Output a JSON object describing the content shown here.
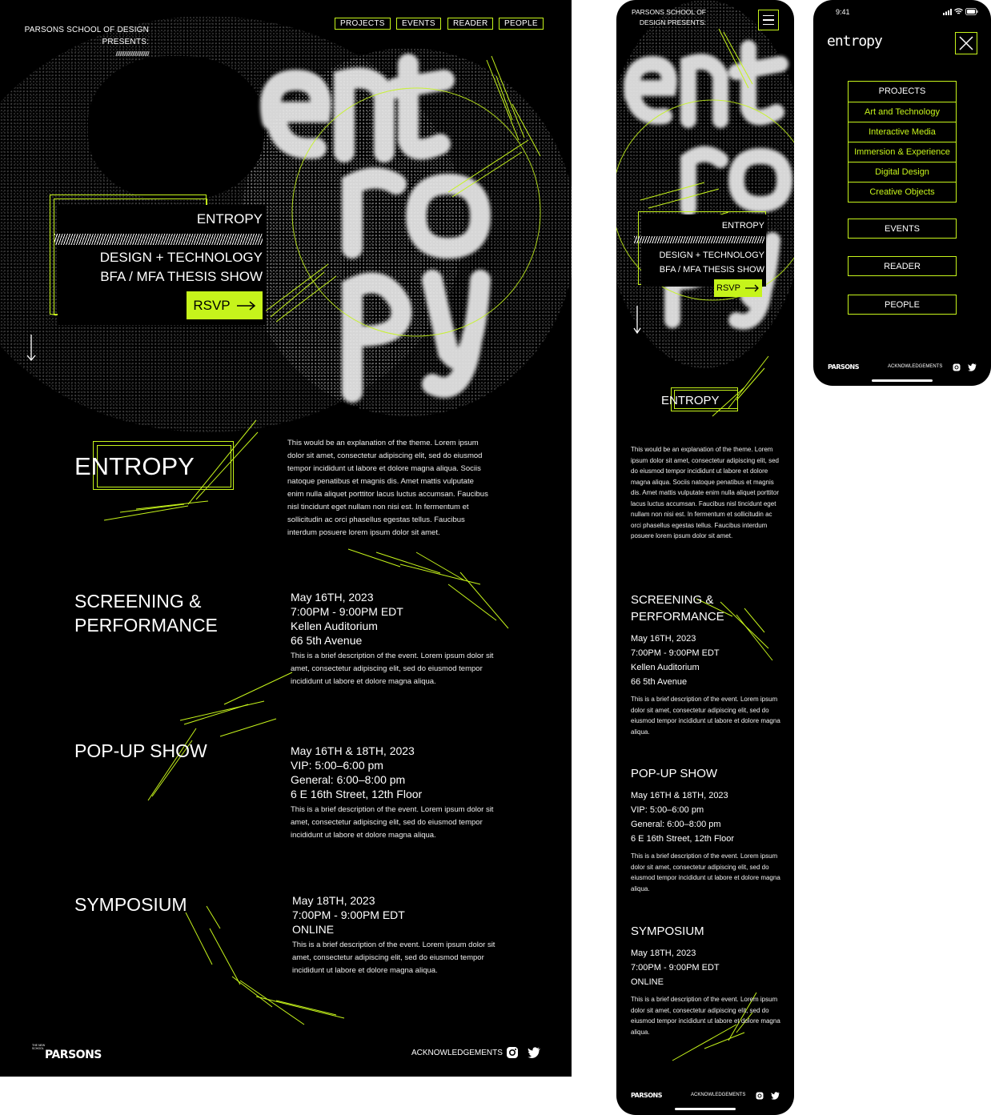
{
  "desktop": {
    "presenter_line1": "PARSONS SCHOOL OF DESIGN",
    "presenter_line2": "PRESENTS:",
    "presenter_slashes": "////////////////////////",
    "nav": [
      "PROJECTS",
      "EVENTS",
      "READER",
      "PEOPLE"
    ],
    "hero": {
      "title": "ENTROPY",
      "subtitle1": "DESIGN + TECHNOLOGY",
      "subtitle2": "BFA / MFA THESIS SHOW",
      "rsvp_label": "RSVP"
    },
    "about": {
      "heading": "ENTROPY",
      "body": "This would be an explanation of the theme. Lorem ipsum dolor sit amet, consectetur adipiscing elit, sed do eiusmod tempor incididunt ut labore et dolore magna aliqua. Sociis natoque penatibus et magnis dis. Amet mattis vulputate enim nulla aliquet porttitor lacus luctus accumsan. Faucibus nisl tincidunt eget nullam non nisi est. In fermentum et sollicitudin ac orci phasellus egestas tellus. Faucibus interdum posuere lorem ipsum dolor sit amet."
    },
    "events": [
      {
        "title1": "SCREENING &",
        "title2": "PERFORMANCE",
        "lines": [
          "May 16TH, 2023",
          "7:00PM - 9:00PM EDT",
          "Kellen Auditorium",
          "66 5th Avenue"
        ],
        "desc": "This is a brief description of the event. Lorem ipsum dolor sit amet, consectetur adipiscing elit, sed do eiusmod tempor incididunt ut labore et dolore magna aliqua."
      },
      {
        "title1": "POP-UP SHOW",
        "title2": "",
        "lines": [
          "May 16TH & 18TH, 2023",
          "VIP: 5:00–6:00 pm",
          "General: 6:00–8:00 pm",
          "6 E 16th Street, 12th Floor"
        ],
        "desc": "This is a brief description of the event. Lorem ipsum dolor sit amet, consectetur adipiscing elit, sed do eiusmod tempor incididunt ut labore et dolore magna aliqua."
      },
      {
        "title1": "SYMPOSIUM",
        "title2": "",
        "lines": [
          "May 18TH, 2023",
          "7:00PM - 9:00PM EDT",
          "ONLINE"
        ],
        "desc": "This is a brief description of the event. Lorem ipsum dolor sit amet, consectetur adipiscing elit, sed do eiusmod tempor incididunt ut labore et dolore magna aliqua."
      }
    ],
    "footer": {
      "logo": "PARSONS",
      "logo_small": "THE NEW SCHOOL",
      "acknowledgements": "ACKNOWLEDGEMENTS"
    }
  },
  "mobile": {
    "presenter_line1": "PARSONS SCHOOL OF",
    "presenter_line2": "DESIGN PRESENTS:",
    "hero": {
      "title": "ENTROPY",
      "subtitle1": "DESIGN + TECHNOLOGY",
      "subtitle2": "BFA / MFA THESIS SHOW",
      "rsvp_label": "RSVP"
    },
    "about_heading": "ENTROPY",
    "about_body": "This would be an explanation of the theme. Lorem ipsum dolor sit amet, consectetur adipiscing elit, sed do eiusmod tempor incididunt ut labore et dolore magna aliqua. Sociis natoque penatibus et magnis dis. Amet mattis vulputate enim nulla aliquet porttitor lacus luctus accumsan. Faucibus nisl tincidunt eget nullam non nisi est. In fermentum et sollicitudin ac orci phasellus egestas tellus. Faucibus interdum posuere lorem ipsum dolor sit amet.",
    "footer": {
      "logo": "PARSONS",
      "acknowledgements": "ACKNOWLEDGEMENTS"
    }
  },
  "menu_screen": {
    "time": "9:41",
    "logo": "entropy",
    "projects_label": "PROJECTS",
    "project_categories": [
      "Art and Technology",
      "Interactive Media",
      "Immersion & Experience",
      "Digital Design",
      "Creative Objects"
    ],
    "events_label": "EVENTS",
    "reader_label": "READER",
    "people_label": "PEOPLE",
    "footer": {
      "logo": "PARSONS",
      "acknowledgements": "ACKNOWLEDGEMENTS"
    }
  },
  "colors": {
    "accent": "#c6f41b",
    "background": "#000000",
    "text": "#ffffff"
  },
  "icons": [
    "arrow-right-icon",
    "arrow-down-icon",
    "hamburger-icon",
    "close-icon",
    "instagram-icon",
    "twitter-icon",
    "signal-icon",
    "wifi-icon",
    "battery-icon"
  ]
}
